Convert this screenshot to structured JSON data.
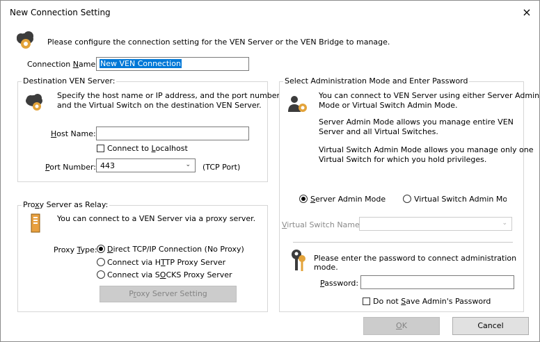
{
  "window": {
    "title": "New Connection Setting",
    "close_glyph": "×"
  },
  "intro": {
    "text": "Please configure the connection setting for the VEN Server or the VEN Bridge to manage."
  },
  "connection_name": {
    "label_pre": "Connection ",
    "label_acc": "N",
    "label_post": "ame:",
    "value": "New VEN Connection"
  },
  "destination": {
    "legend": "Destination VEN Server:",
    "desc_line1": "Specify the host name or IP address, and the port number",
    "desc_line2": "and the Virtual Switch on the destination VEN Server.",
    "host_label_acc": "H",
    "host_label_post": "ost Name:",
    "host_value": "",
    "localhost_pre": "Connect to ",
    "localhost_acc": "L",
    "localhost_post": "ocalhost",
    "port_label_acc": "P",
    "port_label_post": "ort Number:",
    "port_value": "443",
    "port_unit": "(TCP Port)"
  },
  "proxy": {
    "legend_pre": "Pro",
    "legend_acc": "x",
    "legend_post": "y Server as Relay:",
    "desc": "You can connect to a VEN Server via a proxy server.",
    "type_label_pre": "Proxy ",
    "type_label_acc": "T",
    "type_label_post": "ype:",
    "opt1_acc": "D",
    "opt1_post": "irect TCP/IP Connection (No Proxy)",
    "opt2_pre": "Connect via H",
    "opt2_acc": "T",
    "opt2_post": "TP Proxy Server",
    "opt3_pre": "Connect via S",
    "opt3_acc": "O",
    "opt3_post": "CKS Proxy Server",
    "setting_button_pre": "P",
    "setting_button_acc": "r",
    "setting_button_post": "oxy Server Setting"
  },
  "admin": {
    "legend": "Select Administration Mode and Enter Password",
    "desc1_line1": "You can connect to VEN Server using either Server Admin",
    "desc1_line2": "Mode or Virtual Switch Admin Mode.",
    "desc2_line1": "Server Admin Mode allows you manage entire VEN",
    "desc2_line2": "Server and all Virtual Switches.",
    "desc3_line1": "Virtual Switch Admin Mode allows you manage only one",
    "desc3_line2": "Virtual Switch for which you hold privileges.",
    "mode_server_acc": "S",
    "mode_server_post": "erver Admin Mode",
    "mode_vs": "Virtual Switch Admin Mode",
    "vs_name_acc": "V",
    "vs_name_post": "irtual Switch Name:",
    "vs_name_value": "",
    "pw_line1": "Please enter the password to connect administration",
    "pw_line2": "mode.",
    "pw_label_acc": "P",
    "pw_label_post": "assword:",
    "pw_value": "",
    "no_save_pre": "Do not ",
    "no_save_acc": "S",
    "no_save_post": "ave Admin's Password"
  },
  "buttons": {
    "ok_acc": "O",
    "ok_post": "K",
    "cancel": "Cancel"
  }
}
